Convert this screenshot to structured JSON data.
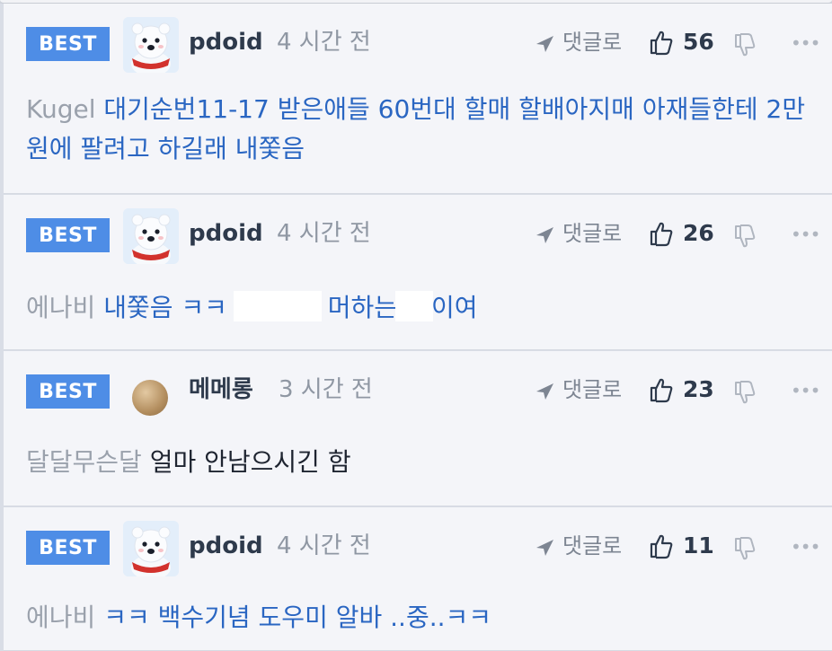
{
  "comments": [
    {
      "badge": "BEST",
      "user": "pdoid",
      "time": "4 시간 전",
      "reply_label": "댓글로",
      "likes": "56",
      "target": "Kugel",
      "text": "대기순번11-17 받은애들 60번대 할매 할배아지매 아재들한테 2만원에 팔려고 하길래 내쫓음"
    },
    {
      "badge": "BEST",
      "user": "pdoid",
      "time": "4 시간 전",
      "reply_label": "댓글로",
      "likes": "26",
      "target": "에나비",
      "text_before": "내쫓음 ㅋㅋ ",
      "text_middle": " 머하는",
      "text_after": "이여"
    },
    {
      "badge": "BEST",
      "user": "메메롱",
      "time": "3 시간 전",
      "reply_label": "댓글로",
      "likes": "23",
      "target": "달달무슨달",
      "text": "얼마 안남으시긴 함"
    },
    {
      "badge": "BEST",
      "user": "pdoid",
      "time": "4 시간 전",
      "reply_label": "댓글로",
      "likes": "11",
      "target": "에나비",
      "text": "ㅋㅋ 백수기념 도우미 알바 ..중..ㅋㅋ"
    }
  ],
  "icons": {
    "reply": "arrow-reply-icon",
    "like": "thumbs-up-icon",
    "dislike": "thumbs-down-icon",
    "more": "more-icon"
  },
  "colors": {
    "badge": "#4e8de6",
    "link_text": "#2a66c2",
    "muted": "#8f97a3"
  }
}
